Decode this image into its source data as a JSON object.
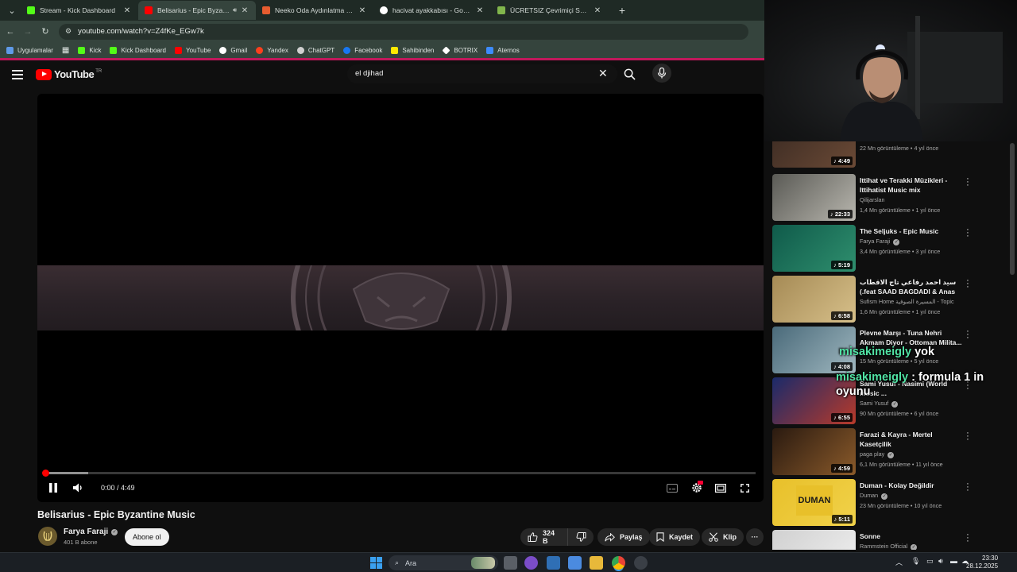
{
  "browser": {
    "tabs": [
      {
        "title": "Stream - Kick Dashboard",
        "favicon_color": "#53fc18",
        "active": false
      },
      {
        "title": "Belisarius - Epic Byzantine M",
        "favicon_color": "#ff0000",
        "active": true,
        "audio": true
      },
      {
        "title": "Neeko Oda Aydınlatma Sistem",
        "favicon_color": "#e65c2f",
        "favicon_text": "hb",
        "active": false
      },
      {
        "title": "hacivat ayakkabısı - Google'da",
        "favicon_color": "#ffffff",
        "active": false
      },
      {
        "title": "ÜCRETSIZ Çevrimiçi Satranç Oy",
        "favicon_color": "#81b64c",
        "active": false
      }
    ],
    "url": "youtube.com/watch?v=Z4fKe_EGw7k",
    "bookmarks": [
      {
        "label": "Uygulamalar",
        "color": "#5f9ae8"
      },
      {
        "label": "Kick",
        "color": "#53fc18"
      },
      {
        "label": "Kick Dashboard",
        "color": "#53fc18"
      },
      {
        "label": "YouTube",
        "color": "#ff0000"
      },
      {
        "label": "Gmail",
        "color": "#ffffff"
      },
      {
        "label": "Yandex",
        "color": "#fc3f1d"
      },
      {
        "label": "ChatGPT",
        "color": "#d0d0d0"
      },
      {
        "label": "Facebook",
        "color": "#1877f2"
      },
      {
        "label": "Sahibinden",
        "color": "#ffe800"
      },
      {
        "label": "BOTRIX",
        "color": "#ffffff"
      },
      {
        "label": "Aternos",
        "color": "#3d8bfd"
      }
    ]
  },
  "youtube": {
    "logo_text": "YouTube",
    "country": "TR",
    "search_query": "el djihad"
  },
  "player": {
    "time": "0:00 / 4:49",
    "progress_fraction": 0,
    "buffered_fraction": 0.06
  },
  "video": {
    "title": "Belisarius - Epic Byzantine Music",
    "channel": "Farya Faraji",
    "subscribers": "401 B abone",
    "subscribe_label": "Abone ol",
    "likes": "324 B",
    "share_label": "Paylaş",
    "save_label": "Kaydet",
    "clip_label": "Klip"
  },
  "recommendations": [
    {
      "title": "",
      "channel": "",
      "meta": "22 Mn görüntüleme • 4 yıl önce",
      "duration": "4:49",
      "thumb": [
        "#3a2a22",
        "#6b4a36"
      ]
    },
    {
      "title": "Ittihat ve Terakki Müzikleri - Ittihatist Music mix",
      "channel": "Qilijarslan",
      "meta": "1,4 Mn görüntüleme • 1 yıl önce",
      "duration": "22:33",
      "thumb": [
        "#5a5a55",
        "#b8b6ae"
      ]
    },
    {
      "title": "The Seljuks - Epic Music",
      "channel": "Farya Faraji",
      "meta": "3,4 Mn görüntüleme • 3 yıl önce",
      "duration": "5:19",
      "thumb": [
        "#0f5a4a",
        "#2f8f6e"
      ],
      "verified": true
    },
    {
      "title": "سيد احمد رفاعي تاج الاقطاب (.feat SAAD BAGDADI & Anas Al-...",
      "channel": "Sufism Home المسيرة الصوفية - Topic",
      "meta": "1,6 Mn görüntüleme • 1 yıl önce",
      "duration": "6:58",
      "thumb": [
        "#a58a55",
        "#d7c08a"
      ]
    },
    {
      "title": "Plevne Marşı - Tuna Nehri Akmam Diyor - Ottoman Milita...",
      "channel": "",
      "meta": "15 Mn görüntüleme • 5 yıl önce",
      "duration": "4:08",
      "thumb": [
        "#4a6a7a",
        "#9fb7bf"
      ]
    },
    {
      "title": "Sami Yusuf - Nasimi (World music ...",
      "channel": "Sami Yusuf",
      "meta": "90 Mn görüntüleme • 6 yıl önce",
      "duration": "6:55",
      "thumb": [
        "#1a2a6a",
        "#b83a2a"
      ],
      "verified": true
    },
    {
      "title": "Farazi & Kayra - Mertel Kasetçilik",
      "channel": "paga play",
      "meta": "6,1 Mn görüntüleme • 11 yıl önce",
      "duration": "4:59",
      "thumb": [
        "#2a1a10",
        "#8a5a2a"
      ],
      "verified": true
    },
    {
      "title": "Duman - Kolay Değildir",
      "channel": "Duman",
      "meta": "23 Mn görüntüleme • 10 yıl önce",
      "duration": "5:11",
      "thumb": [
        "#e8c02a",
        "#f1d24a"
      ],
      "verified": true,
      "thumb_text": "DUMAN"
    },
    {
      "title": "Sonne",
      "channel": "Rammstein Official",
      "meta": "",
      "duration": "",
      "thumb": [
        "#d0d0d0",
        "#f0f0f0"
      ],
      "verified": true
    }
  ],
  "stream_chat": [
    {
      "user": "misakimeigly",
      "message": "yok"
    },
    {
      "user": "misakimeigly",
      "message": ": formula 1 in oyunu"
    }
  ],
  "taskbar": {
    "search_label": "Ara",
    "time": "23:30",
    "date": "28.12.2025"
  }
}
